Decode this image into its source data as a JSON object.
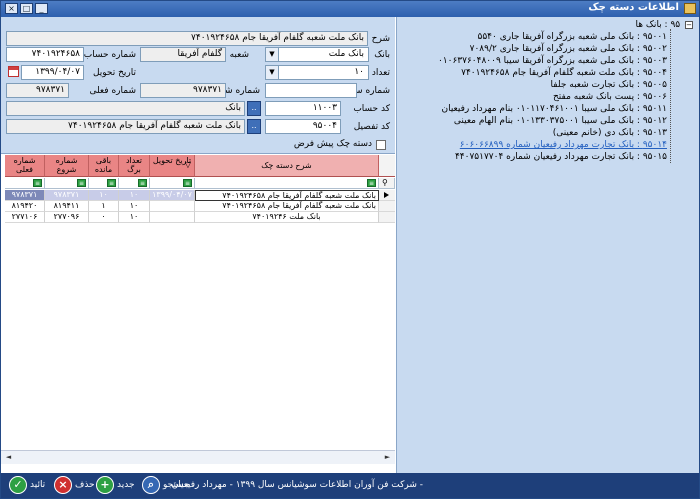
{
  "window": {
    "title": "اطلاعات دسته چک",
    "minimize": "_",
    "maximize": "□",
    "close": "×"
  },
  "form": {
    "description_label": "شرح",
    "description_value": "بانک ملت شعبه گلفام آفریقا جام ۷۴۰۱۹۲۴۶۵۸",
    "bank_label": "بانک",
    "bank_value": "بانک ملت",
    "branch_label": "شعبه",
    "branch_value": "گلفام آفریقا",
    "account_number_label": "شماره حساب",
    "account_number_value": "۷۴۰۱۹۲۴۶۵۸",
    "leaf_count_label": "تعداد برگ",
    "leaf_count_value": "۱۰",
    "delivery_date_label": "تاریخ تحویل",
    "delivery_date_value": "۱۳۹۹/۰۴/۰۷",
    "serial_number_label": "شماره سریال",
    "serial_number_value": "",
    "start_number_label": "شماره شروع",
    "start_number_value": "۹۷۸۳۷۱",
    "current_number_label": "شماره فعلی",
    "current_number_value": "۹۷۸۳۷۱",
    "account_code_label": "کد حساب",
    "account_code_value": "۱۱۰۰۳",
    "account_code_name": "بانک",
    "detail_code_label": "کد تفصیل",
    "detail_code_value": "۹۵۰۰۴",
    "detail_code_name": "بانک ملت شعبه گلفام آفریقا جام ۷۴۰۱۹۲۴۶۵۸",
    "default_checkbox_label": "دسته چک پیش فرض",
    "dots": ".."
  },
  "tree": {
    "root": "۹۵ : بانک ها",
    "items": [
      "۹۵۰۰۱ : بانک ملی شعبه بزرگراه آفریقا جاری ۵۵۴۰",
      "۹۵۰۰۲ : بانک ملی شعبه بزرگراه آفریقا جاری ۷۰۸۹/۲",
      "۹۵۰۰۳ : بانک ملی شعبه بزرگراه آفریقا سیبا ۰۱۰۶۳۷۶۰۴۸۰۰۹",
      "۹۵۰۰۴ : بانک ملت شعبه گلفام آفریقا جام ۷۴۰۱۹۲۴۶۵۸",
      "۹۵۰۰۵ : بانک تجارت شعبه جلفا",
      "۹۵۰۰۶ : پست بانک شعبه مفتح",
      "۹۵۰۱۱ : بانک ملی سیبا ۰۱۰۱۱۷۰۴۶۱۰۰۱ بنام مهرداد رفیعیان",
      "۹۵۰۱۲ : بانک ملی سیبا ۰۱۰۱۳۳۰۳۷۵۰۰۱ بنام الهام معینی",
      "۹۵۰۱۳ : بانک دی (خانم معینی)",
      "۹۵۰۱۴ : بانک تجارت مهرداد رفیعیان شماره ۶۰۶۰۶۶۸۹۹",
      "۹۵۰۱۵ : بانک تجارت مهرداد رفیعیان شماره ۴۴۰۷۵۱۷۷۰۴"
    ],
    "selected_index": 9
  },
  "grid": {
    "columns": [
      "شرح دسته چک",
      "تاریخ تحویل",
      "تعداد برگ",
      "باقی مانده",
      "شماره شروع",
      "شماره فعلی"
    ],
    "filter_icon": "≡",
    "rows": [
      [
        "بانک ملت شعبه گلفام آفریقا جام ۷۴۰۱۹۲۴۶۵۸",
        "۱۳۹۹/۰۴/۰۷",
        "۱۰",
        "۱۰",
        "۹۷۸۳۷۱",
        "۹۷۸۳۷۱"
      ],
      [
        "بانک ملت شعبه گلفام آفریقا جام ۷۴۰۱۹۲۴۶۵۸",
        "",
        "۱۰",
        "۱",
        "۸۱۹۴۱۱",
        "۸۱۹۴۲۰"
      ],
      [
        "بانک ملت ۷۴۰۱۹۲۴۶",
        "",
        "۱۰",
        "۰",
        "۲۷۷۰۹۶",
        "۲۷۷۱۰۶"
      ]
    ]
  },
  "statusbar": {
    "company": "- شرکت فن آوران اطلاعات سوشیانس سال ۱۳۹۹ - مهرداد رفیعیان",
    "search_label": "جستجو",
    "new_label": "جدید",
    "delete_label": "حذف",
    "confirm_label": "تائید"
  },
  "colors": {
    "accent": "#2d5fae",
    "header": "#e98585",
    "panel": "#c8daf0",
    "status": "#1e3f7a"
  }
}
